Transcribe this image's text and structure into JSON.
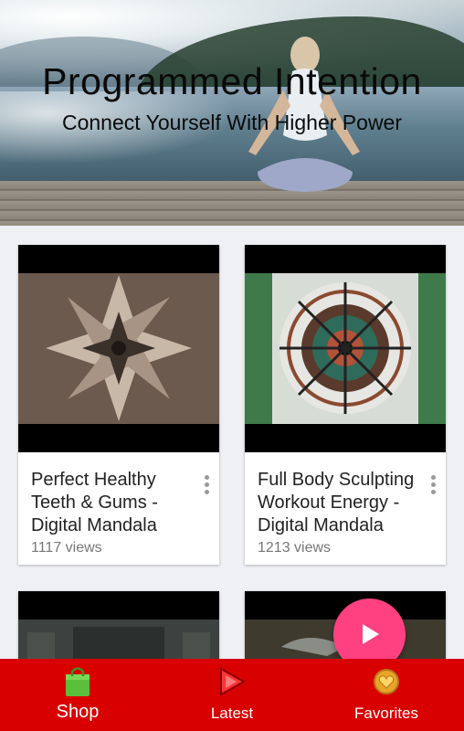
{
  "header": {
    "title": "Programmed Intention",
    "subtitle": "Connect Yourself With Higher Power"
  },
  "videos": [
    {
      "title_line1": "Perfect Healthy",
      "title_line2": "Teeth & Gums -",
      "title_line3": "Digital Mandala",
      "views": "1117 views"
    },
    {
      "title_line1": "Full Body Sculpting",
      "title_line2": "Workout Energy -",
      "title_line3": "Digital Mandala",
      "views": "1213 views"
    }
  ],
  "fab": {
    "icon": "play-icon",
    "color": "#ff4081"
  },
  "bottom_nav": {
    "background": "#d80000",
    "items": [
      {
        "label": "Shop",
        "icon": "shopping-bag-icon"
      },
      {
        "label": "Latest",
        "icon": "play-arrow-icon"
      },
      {
        "label": "Favorites",
        "icon": "favorite-badge-icon"
      }
    ]
  }
}
